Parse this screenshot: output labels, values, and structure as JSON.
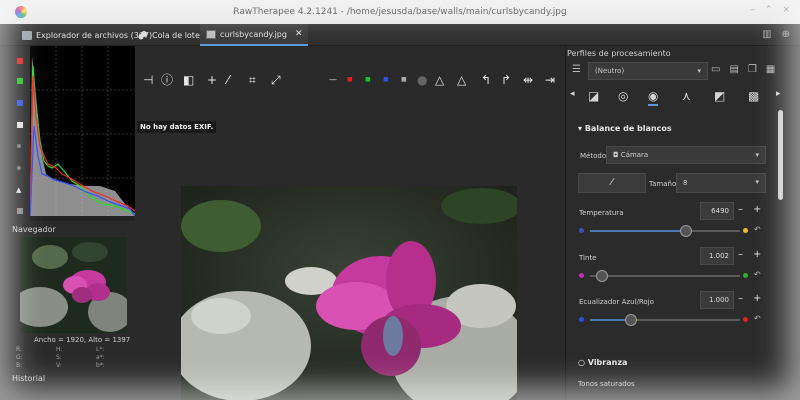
{
  "window": {
    "title": "RawTherapee 4.2.1241 - /home/jesusda/base/walls/main/curlsbycandy.jpg"
  },
  "tabs": [
    {
      "label": "Explorador de archivos (367)",
      "icon": "folder-icon"
    },
    {
      "label": "Cola de lotes",
      "icon": "queue-icon"
    },
    {
      "label": "curlsbycandy.jpg",
      "icon": "image-icon",
      "active": true
    }
  ],
  "left": {
    "navigator_label": "Navegador",
    "image_size": "Ancho = 1920, Alto = 1397",
    "channel_labels": [
      "R:",
      "G:",
      "B:",
      "H:",
      "S:",
      "V:",
      "L*:",
      "a*:",
      "b*:"
    ],
    "history_label": "Historial",
    "histogram_colors": {
      "red": "#ff2020",
      "green": "#20e020",
      "blue": "#3050ff",
      "luma": "#bdbdbd"
    }
  },
  "viewer": {
    "exif_message": "No hay datos EXIF."
  },
  "right": {
    "profiles_title": "Perfiles de procesamiento",
    "profile_value": "(Neutro)",
    "white_balance": {
      "title": "Balance de blancos",
      "method_label": "Método",
      "method_value": "Cámara",
      "size_label": "Tamaño:",
      "size_value": "8",
      "params": [
        {
          "label": "Temperatura",
          "value": "6490",
          "level": 0.64
        },
        {
          "label": "Tinte",
          "value": "1.002",
          "level": 0.08
        },
        {
          "label": "Ecualizador Azul/Rojo",
          "value": "1.000",
          "level": 0.27
        }
      ]
    },
    "vibrance_title": "Vibranza",
    "vibrance_first_label": "Tonos saturados"
  },
  "colors": {
    "accent": "#5a9bd5",
    "panel": "#2b2b2b",
    "titlebar": "#e8e8e8"
  }
}
